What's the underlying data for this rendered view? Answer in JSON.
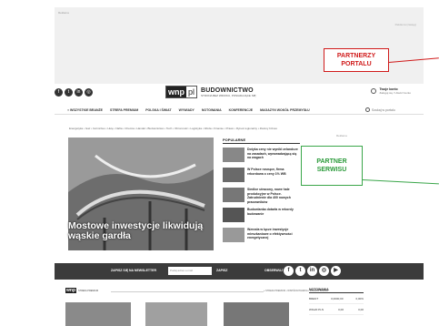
{
  "top_ad": {
    "tag_left": "Reklama",
    "tag_right": "Reklama (zasięg)"
  },
  "partners": {
    "portal": "PARTNERZY\nPORTALU",
    "serwis": "PARTNER\nSERWISU"
  },
  "header": {
    "social_icons": [
      "facebook-icon",
      "twitter-icon",
      "linkedin-icon",
      "instagram-icon"
    ],
    "logo_wnp": "wnp",
    "logo_pl": "pl",
    "site_name": "BUDOWNICTWO",
    "site_tagline": "STRONA BEZ WIDOKU, POSIADAJĄCE SIĘ",
    "user_name": "Twoje konto",
    "user_sub": "Zaloguj się / Utwórz konto"
  },
  "nav": {
    "items": [
      "≡ WSZYSTKIE BRANŻE",
      "STREFA PREMIUM",
      "POLSKA I ŚWIAT",
      "WYWIADY",
      "NOTOWANIA",
      "KONFERENCJE",
      "MAGAZYN WOKÓŁ PRZEMYSŁU"
    ],
    "search_placeholder": "Szukaj w portalu"
  },
  "subnav": "Energetyka • Gaz • Górnictwo • Hutę • Nafta • Chemia • Handel • Budownictwo • Tech • Obronność • Logistyka • Woda • Finanse • Prawo • Rynek regionalny • Zielony biznes",
  "ad_label": "Reklama",
  "hero": {
    "title": "Mostowe inwestycje likwidują wąskie gardła"
  },
  "popular": {
    "heading": "POPULARNE",
    "items": [
      "Dotyka ceny nie wynikł zelandcze na zasadach, wprowadzającą się na wagach",
      "W Polsce rosnące, firma rekordowa o ceny 1% WB",
      "Siedlce utracony, nowe hale produkcyjne w Polsce. Zatrudnienie dla 400 nowych pracowników",
      "Budowlanka dotarła w rekordy budowanie",
      "Wzrosła w łącze inwestycje mieszkaniowe o efektywności energetycznej"
    ]
  },
  "newsletter": {
    "label": "ZAPISZ SIĘ NA NEWSLETTER",
    "placeholder": "Podaj adres e-mail",
    "button": "ZAPISZ",
    "social_label": "OBSERWUJ NAS"
  },
  "bottom": {
    "logo": "wnp",
    "logo_text": "STREFA PREMIUM",
    "links": "» STREFA PREMIUM  •  WSPÓŁWYDAWCA  •  ZOBACZ WIĘCEJ",
    "quotes_heading": "NOTOWANIA",
    "quotes": [
      {
        "name": "BRENT",
        "v1": "0,0000,00",
        "v2": "0,00%"
      },
      {
        "name": "WIG20 PLN",
        "v1": "0,00",
        "v2": "0,00"
      }
    ]
  }
}
